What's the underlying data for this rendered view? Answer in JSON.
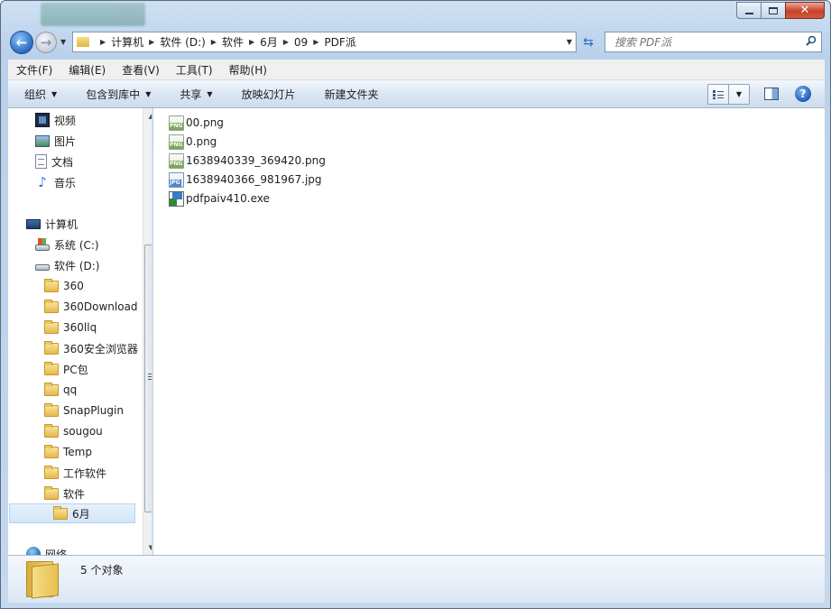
{
  "address": {
    "breadcrumbs": [
      "计算机",
      "软件 (D:)",
      "软件",
      "6月",
      "09",
      "PDF派"
    ]
  },
  "search": {
    "placeholder": "搜索 PDF派"
  },
  "menu": [
    "文件(F)",
    "编辑(E)",
    "查看(V)",
    "工具(T)",
    "帮助(H)"
  ],
  "toolbar": {
    "organize": "组织",
    "include_in_library": "包含到库中",
    "share": "共享",
    "slideshow": "放映幻灯片",
    "new_folder": "新建文件夹"
  },
  "nav": {
    "favorites": [
      {
        "label": "视频",
        "icon": "video-library-icon"
      },
      {
        "label": "图片",
        "icon": "pictures-library-icon"
      },
      {
        "label": "文档",
        "icon": "documents-library-icon"
      },
      {
        "label": "音乐",
        "icon": "music-library-icon"
      }
    ],
    "computer": "计算机",
    "drives": [
      {
        "label": "系统 (C:)",
        "icon": "system-drive-icon"
      },
      {
        "label": "软件 (D:)",
        "icon": "drive-icon"
      }
    ],
    "folders": [
      "360",
      "360Download",
      "360llq",
      "360安全浏览器",
      "PC包",
      "qq",
      "SnapPlugin",
      "sougou",
      "Temp",
      "工作软件",
      "软件"
    ],
    "selected_folder": "6月",
    "network": "网络"
  },
  "files": [
    {
      "name": "00.png",
      "type": "png"
    },
    {
      "name": "0.png",
      "type": "png"
    },
    {
      "name": "1638940339_369420.png",
      "type": "png"
    },
    {
      "name": "1638940366_981967.jpg",
      "type": "jpg"
    },
    {
      "name": "pdfpaiv410.exe",
      "type": "exe"
    }
  ],
  "status": {
    "count": "5 个对象"
  },
  "colors": {
    "accent": "#2a6bc3",
    "selection": "#d2e6f8",
    "close": "#c7412a"
  }
}
